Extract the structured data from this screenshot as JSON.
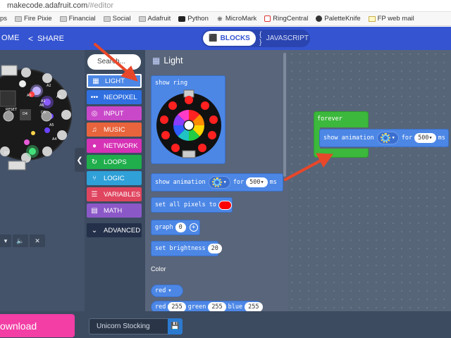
{
  "browser": {
    "url_host": "makecode.adafruit.com",
    "url_path": "/#editor",
    "bookmarks": [
      {
        "label": "ps",
        "icon": "apps-icon"
      },
      {
        "label": "Fire Pixie",
        "icon": "folder-icon"
      },
      {
        "label": "Financial",
        "icon": "folder-icon"
      },
      {
        "label": "Social",
        "icon": "folder-icon"
      },
      {
        "label": "Adafruit",
        "icon": "folder-icon"
      },
      {
        "label": "Python",
        "icon": "python-icon"
      },
      {
        "label": "MicroMark",
        "icon": "micromark-icon"
      },
      {
        "label": "RingCentral",
        "icon": "ringcentral-icon"
      },
      {
        "label": "PaletteKnife",
        "icon": "paletteknife-icon"
      },
      {
        "label": "FP web mail",
        "icon": "webmail-icon"
      }
    ]
  },
  "header": {
    "home_label": "OME",
    "share_label": "SHARE",
    "blocks_label": "BLOCKS",
    "javascript_label": "JAVASCRIPT"
  },
  "simulator": {
    "board_labels": [
      "A0",
      "A6",
      "A1",
      "RESET",
      "D4",
      "A5",
      "A2",
      "A3",
      "D5",
      "A4",
      "D7"
    ],
    "controls": [
      "audio-icon",
      "mute-icon",
      "fullscreen-icon"
    ]
  },
  "toolbox": {
    "search_placeholder": "Search...",
    "categories": [
      {
        "label": "LIGHT",
        "icon": "grid-icon",
        "color": "#4c87e6",
        "selected": true
      },
      {
        "label": "NEOPIXEL",
        "icon": "dots-icon",
        "color": "#2f6fe0"
      },
      {
        "label": "INPUT",
        "icon": "target-icon",
        "color": "#c948c9"
      },
      {
        "label": "MUSIC",
        "icon": "headphones-icon",
        "color": "#e8643c"
      },
      {
        "label": "NETWORK",
        "icon": "chat-icon",
        "color": "#d632b5"
      },
      {
        "label": "LOOPS",
        "icon": "loop-icon",
        "color": "#1fae4b"
      },
      {
        "label": "LOGIC",
        "icon": "branch-icon",
        "color": "#2fa0d8"
      },
      {
        "label": "VARIABLES",
        "icon": "list-icon",
        "color": "#e0455f"
      },
      {
        "label": "MATH",
        "icon": "calculator-icon",
        "color": "#8b58c8"
      }
    ],
    "advanced_label": "ADVANCED"
  },
  "flyout": {
    "title": "Light",
    "show_ring": "show ring",
    "show_animation": {
      "label": "show animation",
      "for_label": "for",
      "duration": "500",
      "unit": "ms"
    },
    "set_all_pixels": "set all pixels to",
    "graph": {
      "label": "graph",
      "value": "0"
    },
    "set_brightness": {
      "label": "set brightness",
      "value": "20"
    },
    "color_heading": "Color",
    "color_red": "red",
    "rgb": {
      "red_label": "red",
      "red": "255",
      "green_label": "green",
      "green": "255",
      "blue_label": "blue",
      "blue": "255"
    },
    "ring_colors": [
      "#ff2222",
      "#ff8c00",
      "#ffd600",
      "#22cc44",
      "#1fc3c3",
      "#2e5cff",
      "#8a3cff",
      "#ff3cc8",
      "#ffffff"
    ]
  },
  "workspace": {
    "forever_label": "forever",
    "animation_block": {
      "label": "show animation",
      "for_label": "for",
      "duration": "500",
      "unit": "ms"
    }
  },
  "footer": {
    "download_label": "ownload",
    "project_name": "Unicorn Stocking"
  },
  "annotation_color": "#e8472a"
}
